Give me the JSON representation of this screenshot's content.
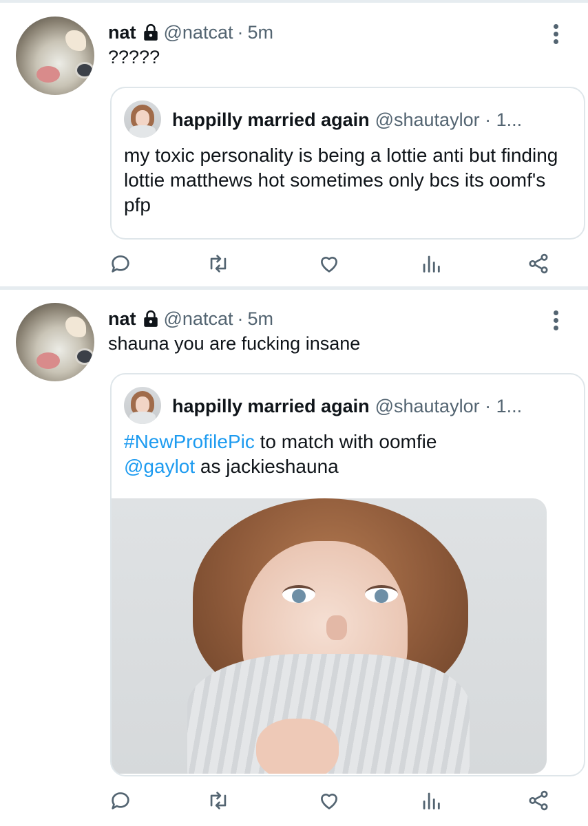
{
  "tweets": [
    {
      "author": {
        "name": "nat",
        "handle": "@natcat",
        "time": "5m",
        "avatar_icon": "cat-avatar"
      },
      "text": "?????",
      "quoted": {
        "author": {
          "name": "happilly married again",
          "handle": "@shautaylor · 1..."
        },
        "text": "my toxic personality is being a lottie anti but finding lottie matthews hot sometimes only bcs its oomf's pfp"
      }
    },
    {
      "author": {
        "name": "nat",
        "handle": "@natcat",
        "time": "5m",
        "avatar_icon": "cat-avatar"
      },
      "text": "shauna you are fucking insane",
      "quoted": {
        "author": {
          "name": "happilly married again",
          "handle": "@shautaylor · 1..."
        },
        "text_parts": {
          "hashtag": "#NewProfilePic",
          "middle": " to match with oomfie",
          "mention": "@gaylot",
          "end": " as jackieshauna"
        },
        "image": "woman-in-knit-scarf-photo"
      }
    }
  ],
  "separator": "·",
  "icons": {
    "lock": "lock-icon",
    "more": "more-icon",
    "reply": "reply-icon",
    "retweet": "retweet-icon",
    "like": "like-icon",
    "stats": "stats-icon",
    "share": "share-icon"
  },
  "colors": {
    "text": "#0f1419",
    "secondary": "#536471",
    "link": "#1d9bf0",
    "border": "#dfe6ea"
  }
}
